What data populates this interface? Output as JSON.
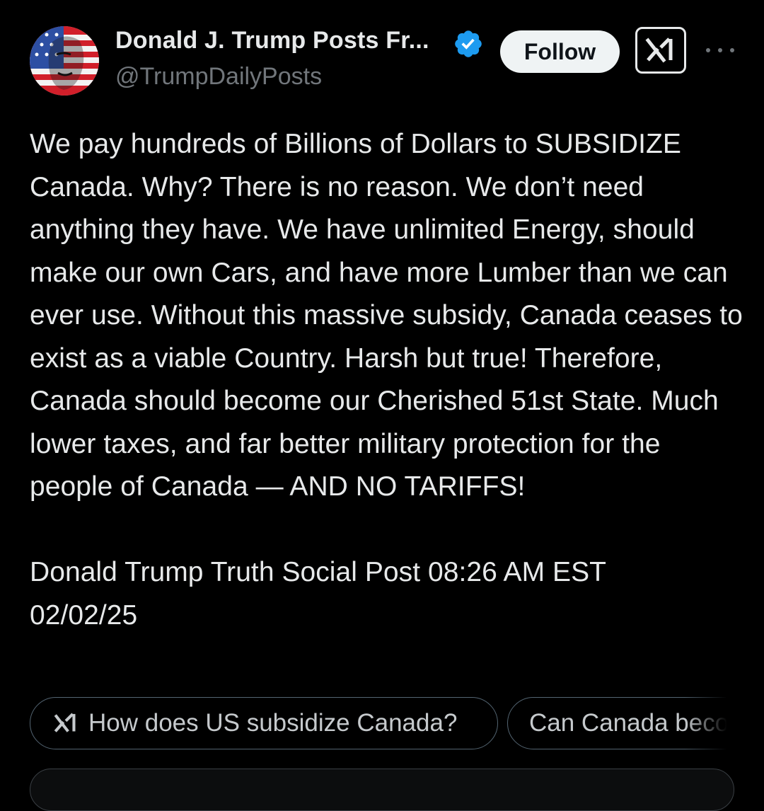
{
  "post": {
    "author": {
      "display_name": "Donald J. Trump Posts Fr...",
      "handle": "@TrumpDailyPosts",
      "verified": true
    },
    "follow_label": "Follow",
    "text": "We pay hundreds of Billions of Dollars to SUBSIDIZE Canada. Why? There is no reason. We don’t need anything they have. We have unlimited Energy, should make our own Cars, and have more Lumber than we can ever use. Without this massive subsidy, Canada ceases to exist as a viable Country. Harsh but true! Therefore, Canada should become our Cherished 51st State. Much lower taxes, and far better military protection for the people of Canada — AND NO TARIFFS!\n\nDonald Trump Truth Social Post 08:26 AM EST\n02/02/25"
  },
  "grok_suggestions": [
    {
      "label": "How does US subsidize Canada?"
    },
    {
      "label": "Can Canada become a state?"
    }
  ],
  "icons": {
    "verified": "verified-badge-icon",
    "grok": "grok-icon",
    "more": "more-options-icon"
  },
  "colors": {
    "background": "#000000",
    "text": "#e7e9ea",
    "secondary_text": "#71767b",
    "verified_blue": "#1d9bf0",
    "follow_bg": "#eff3f4",
    "chip_border": "#536471"
  }
}
